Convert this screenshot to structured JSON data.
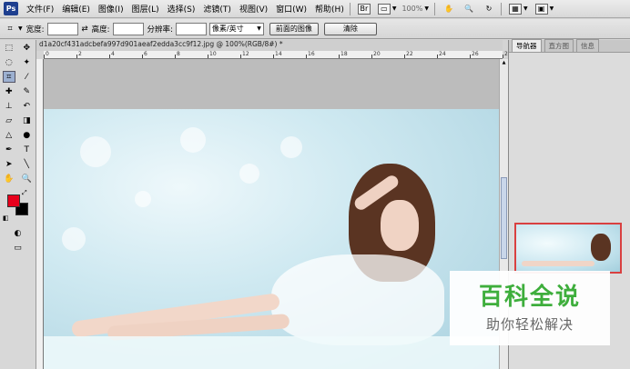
{
  "menu": {
    "logo": "Ps",
    "items": [
      "文件(F)",
      "编辑(E)",
      "图像(I)",
      "图层(L)",
      "选择(S)",
      "滤镜(T)",
      "视图(V)",
      "窗口(W)",
      "帮助(H)"
    ],
    "zoom": "100%"
  },
  "options": {
    "width_label": "宽度:",
    "height_label": "高度:",
    "resolution_label": "分辨率:",
    "unit_select": "像素/英寸",
    "front_image_button": "前面的图像",
    "clear_button": "清除"
  },
  "document": {
    "tab_title": "d1a20cf431adcbefa997d901aeaf2edda3cc9f12.jpg @ 100%(RGB/8#) *",
    "ruler_ticks": [
      "0",
      "2",
      "4",
      "6",
      "8",
      "10",
      "12",
      "14",
      "16",
      "18",
      "20",
      "22",
      "24",
      "26",
      "28"
    ]
  },
  "panel": {
    "tabs": [
      "导航器",
      "直方图",
      "信息"
    ]
  },
  "colors": {
    "foreground": "#e8001c",
    "background": "#000000"
  },
  "watermark": {
    "title": "百科全说",
    "subtitle": "助你轻松解决"
  }
}
